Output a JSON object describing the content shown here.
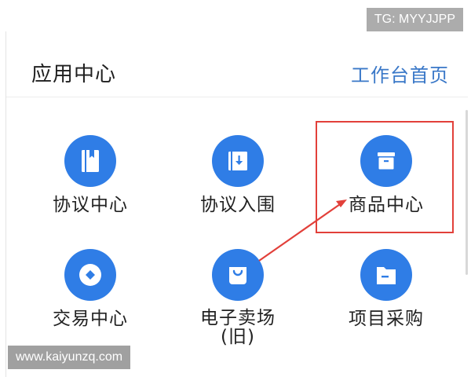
{
  "header": {
    "title": "应用中心",
    "link": "工作台首页"
  },
  "apps": [
    {
      "label": "协议中心",
      "icon": "book-icon"
    },
    {
      "label": "协议入围",
      "icon": "download-doc-icon"
    },
    {
      "label": "商品中心",
      "icon": "archive-icon"
    },
    {
      "label": "交易中心",
      "icon": "diamond-icon"
    },
    {
      "label": "电子卖场\n(旧)",
      "icon": "shopping-bag-icon"
    },
    {
      "label": "项目采购",
      "icon": "folder-icon"
    }
  ],
  "colors": {
    "accent": "#2f7de6",
    "link": "#3a78c8",
    "highlight": "#e2403a"
  },
  "watermarks": {
    "top": "TG: MYYJJPP",
    "bottom": "www.kaiyunzq.com"
  }
}
